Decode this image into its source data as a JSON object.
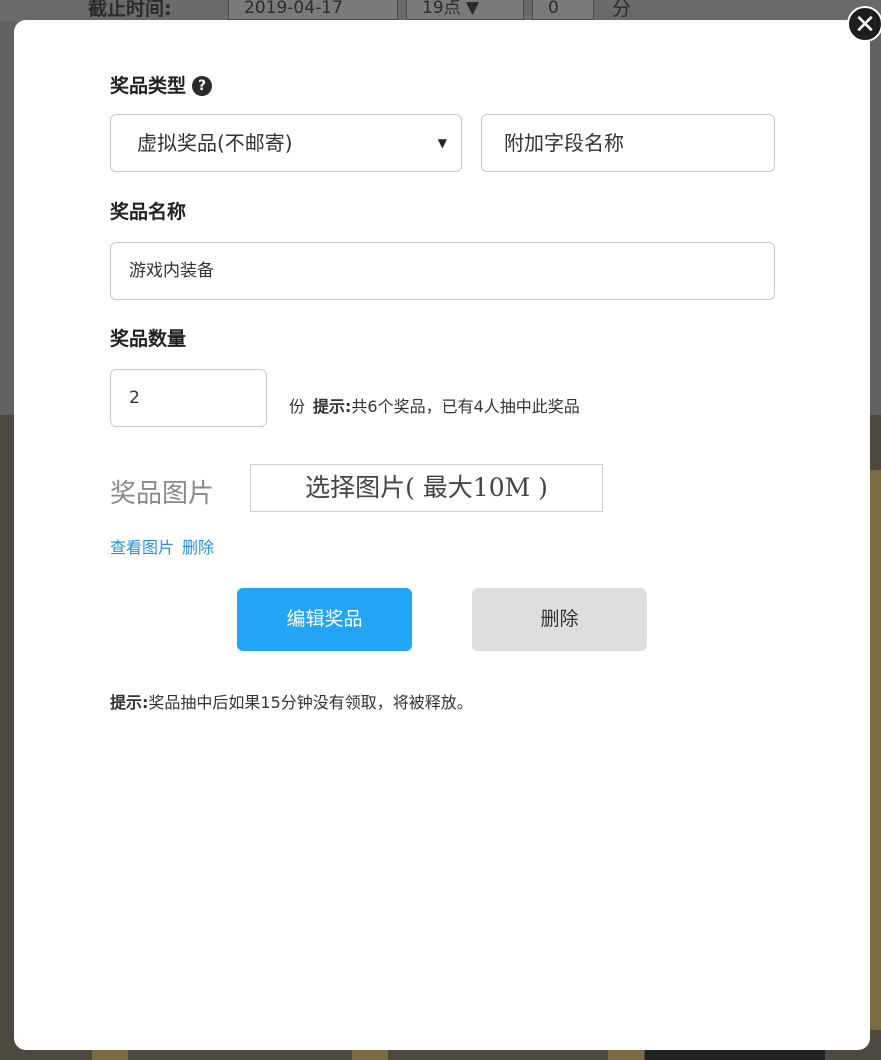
{
  "background": {
    "deadline_label": "截止时间:",
    "deadline_date": "2019-04-17",
    "deadline_hour": "19点 ▼",
    "deadline_minute": "0",
    "minute_unit": "分"
  },
  "modal": {
    "close_icon": "close-icon",
    "prize_type": {
      "label": "奖品类型",
      "help_icon": "?",
      "select_value": "虚拟奖品(不邮寄)",
      "select_arrow": "▼",
      "extra_field_placeholder": "附加字段名称"
    },
    "prize_name": {
      "label": "奖品名称",
      "value": "游戏内装备"
    },
    "prize_quantity": {
      "label": "奖品数量",
      "value": "2",
      "unit": "份",
      "hint_label": "提示:",
      "hint_text": "共6个奖品，已有4人抽中此奖品"
    },
    "prize_image": {
      "label": "奖品图片",
      "select_button": "选择图片( 最大10M )",
      "view_link": "查看图片",
      "delete_link": "删除"
    },
    "actions": {
      "edit_label": "编辑奖品",
      "delete_label": "删除"
    },
    "tip": {
      "label": "提示:",
      "text": "奖品抽中后如果15分钟没有领取，将被释放。"
    }
  }
}
